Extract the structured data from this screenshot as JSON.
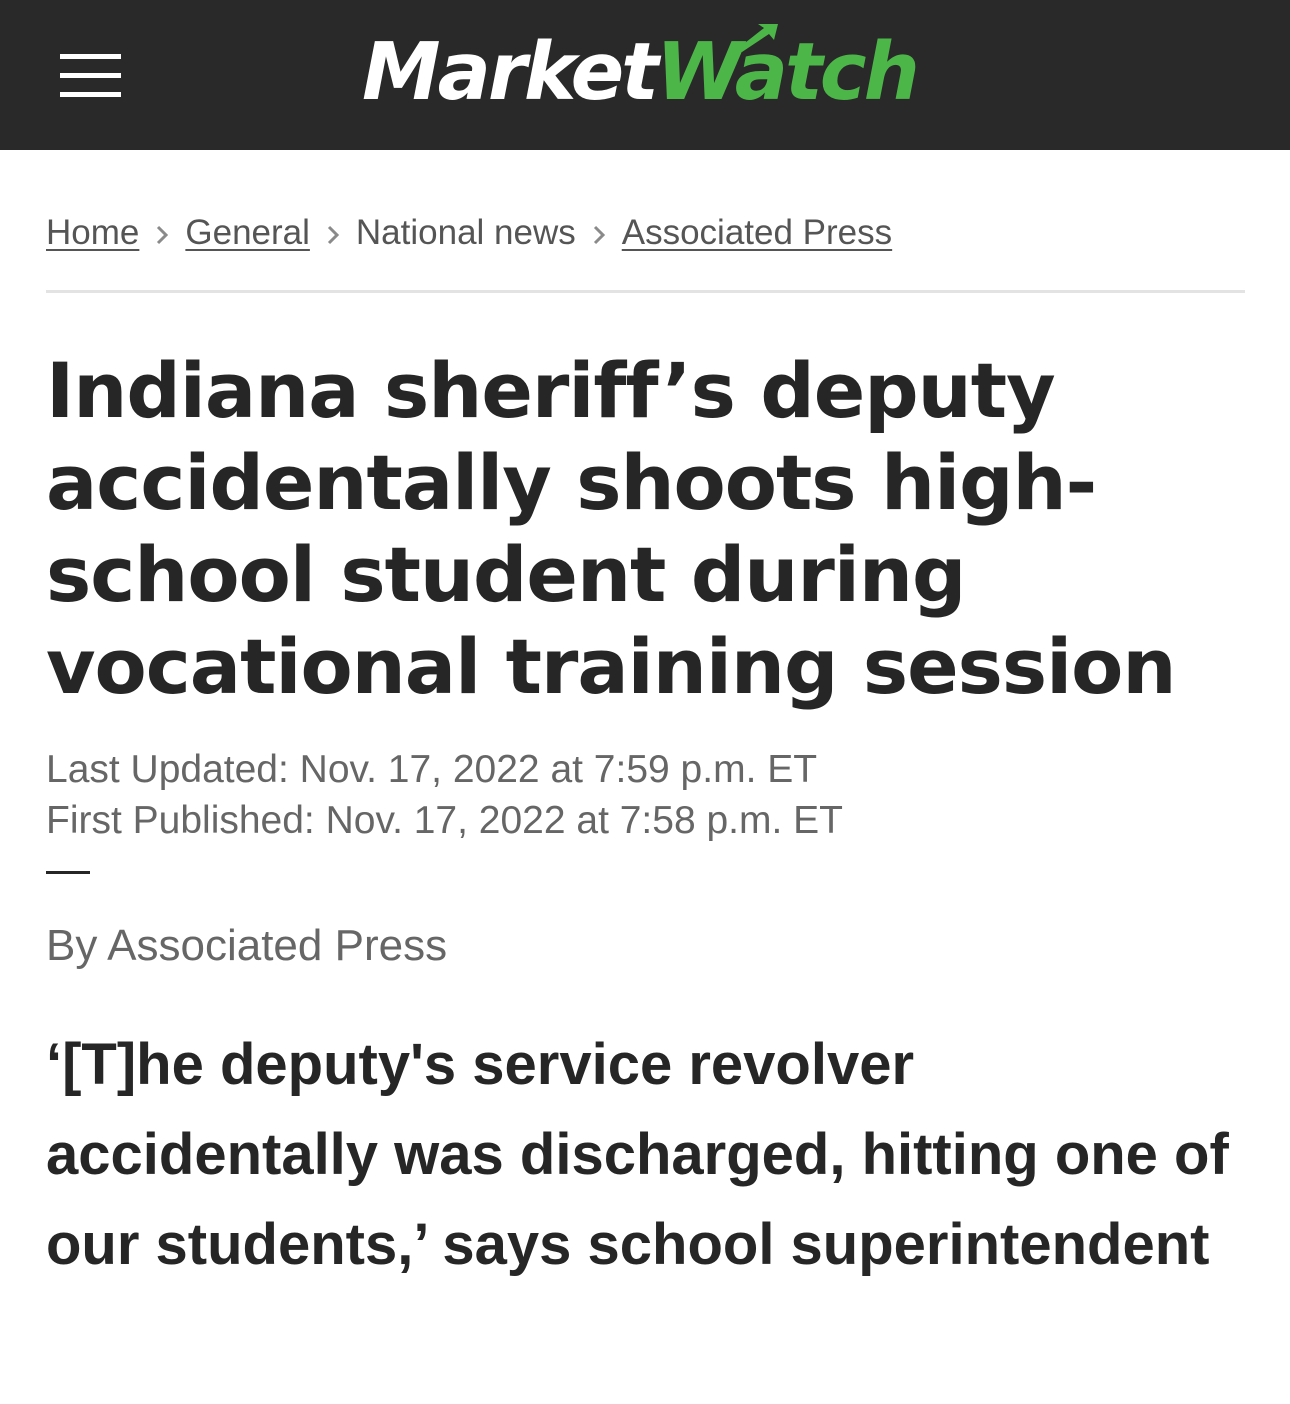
{
  "header": {
    "logo_part1": "Market",
    "logo_part2": "Watch",
    "logo_accent_color": "#4cb649",
    "background_color": "#292929",
    "menu_icon": "hamburger-menu-icon"
  },
  "breadcrumb": {
    "items": [
      {
        "label": "Home",
        "link": true
      },
      {
        "label": "General",
        "link": true
      },
      {
        "label": "National news",
        "link": false
      },
      {
        "label": "Associated Press",
        "link": true
      }
    ],
    "separator_icon": "chevron-right-icon"
  },
  "article": {
    "headline": "Indiana sheriff’s deputy accidentally shoots high-school student during vocational training session",
    "last_updated": "Last Updated: Nov. 17, 2022 at 7:59 p.m. ET",
    "first_published": "First Published: Nov. 17, 2022 at 7:58 p.m. ET",
    "byline": "By Associated Press",
    "subheadline": "‘[T]he deputy's service revolver accidentally was discharged, hitting one of our students,’ says school superintendent"
  }
}
